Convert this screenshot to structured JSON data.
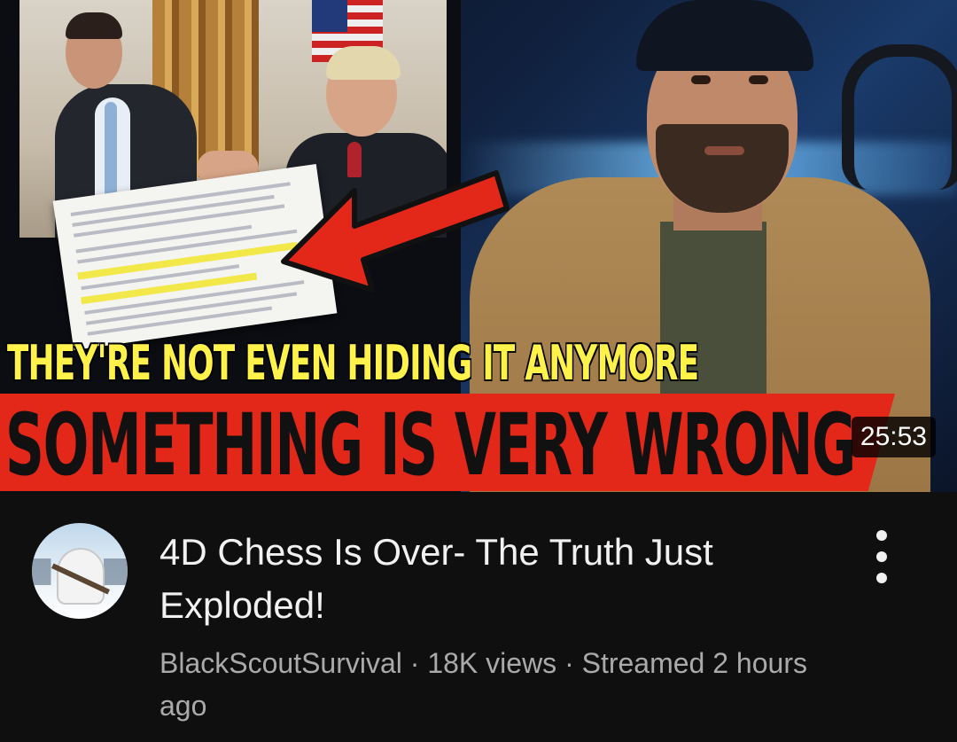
{
  "video": {
    "thumbnail": {
      "caption_top": "THEY'RE NOT EVEN HIDING IT ANYMORE",
      "caption_main": "SOMETHING IS VERY WRONG",
      "duration": "25:53"
    },
    "title": "4D Chess Is Over- The Truth Just Exploded!",
    "channel": "BlackScoutSurvival",
    "separator": " · ",
    "views": "18K views",
    "streamed": "Streamed 2 hours ago",
    "menu_icon": "more-vert-icon"
  },
  "colors": {
    "background": "#0f0f0f",
    "title_text": "#f1f1f1",
    "meta_text": "#aaaaaa",
    "caption_yellow": "#fff24a",
    "banner_red": "#e3281a",
    "arrow_red": "#e3281a"
  }
}
